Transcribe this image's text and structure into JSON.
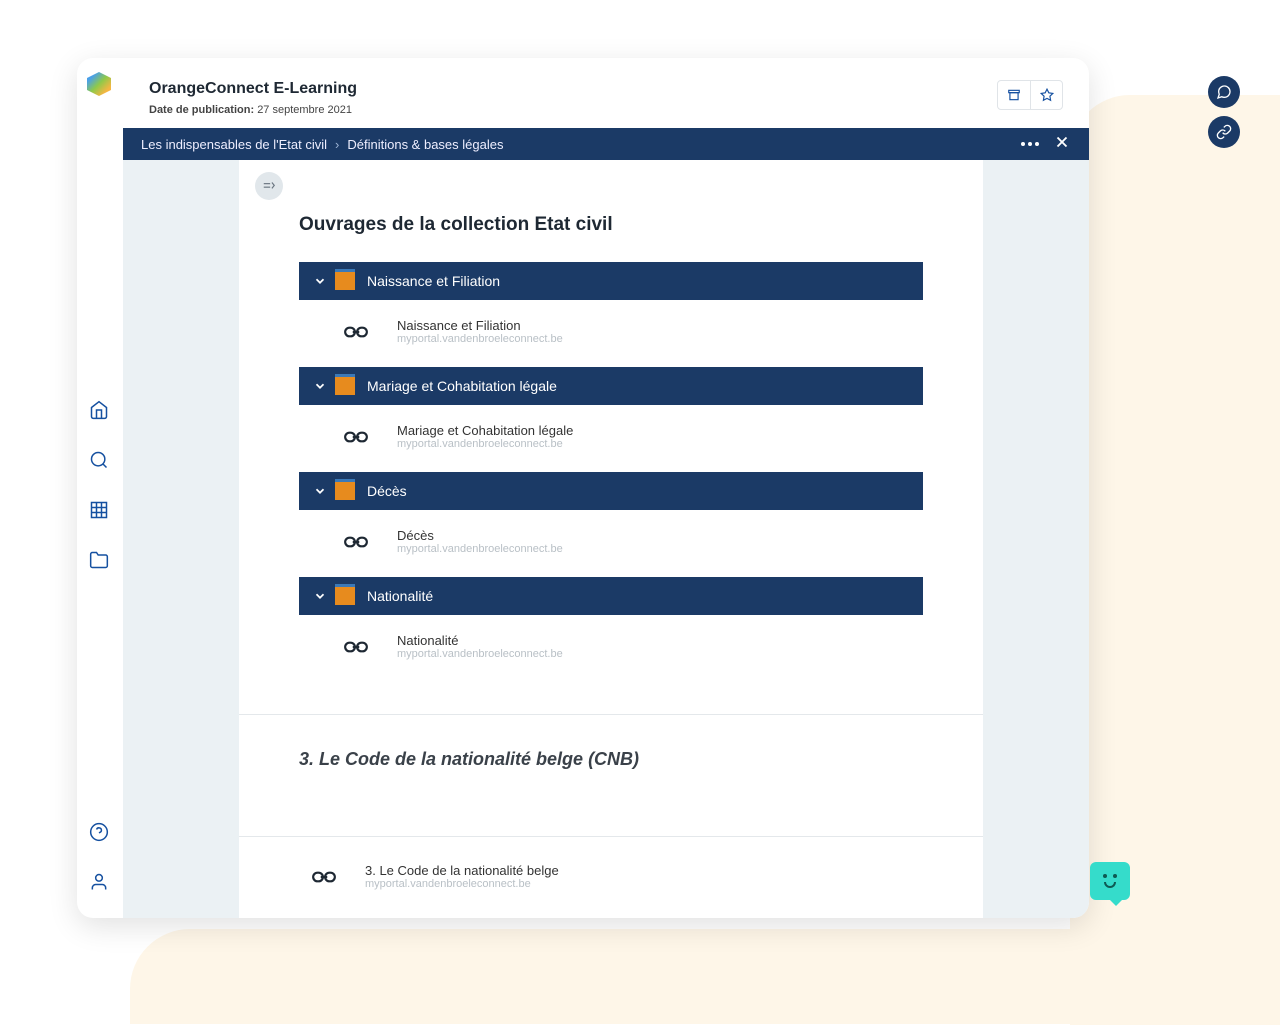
{
  "header": {
    "title": "OrangeConnect E-Learning",
    "meta_label": "Date de publication:",
    "meta_value": "27 septembre 2021"
  },
  "breadcrumb": {
    "item1": "Les indispensables de l'Etat civil",
    "item2": "Définitions & bases légales"
  },
  "section": {
    "title": "Ouvrages de la collection Etat civil"
  },
  "accordion": [
    {
      "header": "Naissance et Filiation",
      "link_title": "Naissance et Filiation",
      "link_url": "myportal.vandenbroeleconnect.be"
    },
    {
      "header": "Mariage et Cohabitation légale",
      "link_title": "Mariage et Cohabitation légale",
      "link_url": "myportal.vandenbroeleconnect.be"
    },
    {
      "header": "Décès",
      "link_title": "Décès",
      "link_url": "myportal.vandenbroeleconnect.be"
    },
    {
      "header": "Nationalité",
      "link_title": "Nationalité",
      "link_url": "myportal.vandenbroeleconnect.be"
    }
  ],
  "cnb": {
    "title": "3. Le Code de la nationalité belge (CNB)",
    "link_title": "3. Le Code de la nationalité belge",
    "link_url": "myportal.vandenbroeleconnect.be"
  }
}
